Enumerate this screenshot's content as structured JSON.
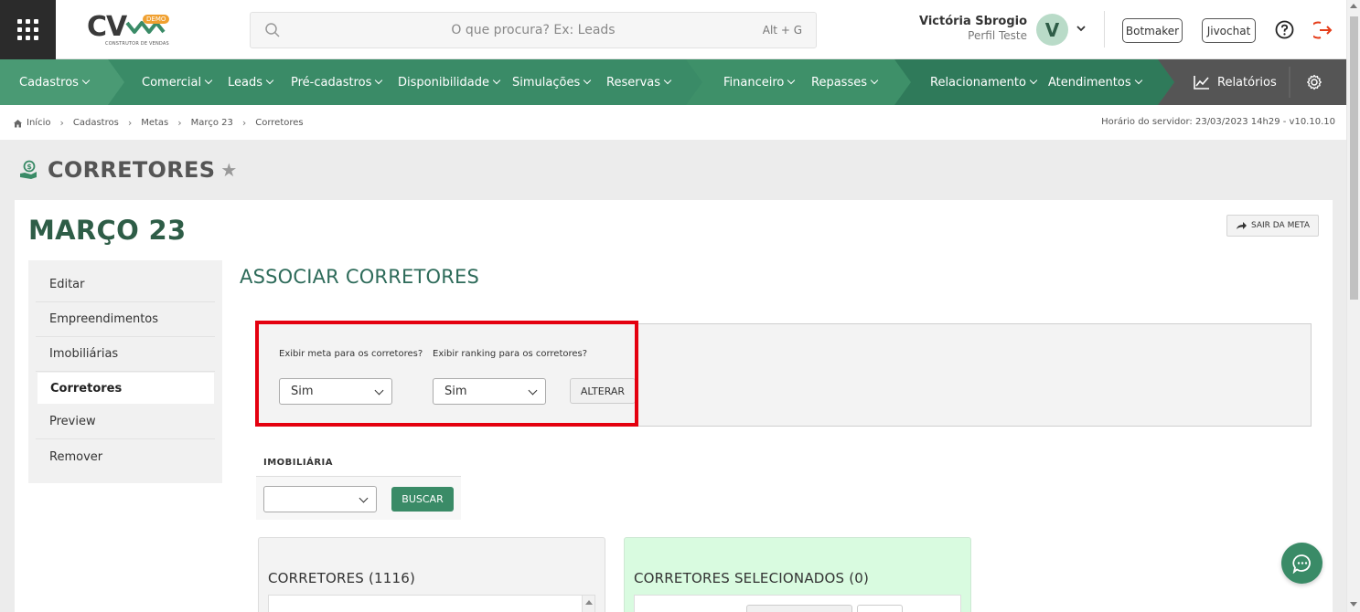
{
  "header": {
    "logo_text": "CV",
    "logo_badge": "DEMO",
    "logo_subtitle": "CONSTRUTOR DE VENDAS",
    "search_placeholder": "O que procura? Ex: Leads",
    "search_shortcut": "Alt + G",
    "user_name": "Victória Sbrogio",
    "user_role": "Perfil Teste",
    "avatar_initial": "V",
    "botmaker_label": "Botmaker",
    "jivochat_label": "Jivochat"
  },
  "nav": {
    "items": [
      {
        "label": "Cadastros"
      },
      {
        "label": "Comercial"
      },
      {
        "label": "Leads"
      },
      {
        "label": "Pré-cadastros"
      },
      {
        "label": "Disponibilidade"
      },
      {
        "label": "Simulações"
      },
      {
        "label": "Reservas"
      },
      {
        "label": "Financeiro"
      },
      {
        "label": "Repasses"
      },
      {
        "label": "Relacionamento"
      },
      {
        "label": "Atendimentos"
      }
    ],
    "reports_label": "Relatórios",
    "colors": {
      "nav": "#3a8b67",
      "dark": "#2d6e54",
      "reports": "#555555",
      "accent": "#2e5d47",
      "highlight": "#e4000f"
    }
  },
  "breadcrumb": {
    "items": [
      "Início",
      "Cadastros",
      "Metas",
      "Março 23",
      "Corretores"
    ],
    "server_time": "Horário do servidor: 23/03/2023 14h29 - v10.10.10"
  },
  "page": {
    "title": "CORRETORES",
    "card_title": "MARÇO 23",
    "exit_label": "SAIR DA META"
  },
  "sidemenu": {
    "items": [
      {
        "label": "Editar"
      },
      {
        "label": "Empreendimentos"
      },
      {
        "label": "Imobiliárias"
      },
      {
        "label": "Corretores"
      },
      {
        "label": "Preview"
      },
      {
        "label": "Remover"
      }
    ]
  },
  "main": {
    "section_title": "ASSOCIAR CORRETORES",
    "show_goal_label": "Exibir meta para os corretores?",
    "show_goal_value": "Sim",
    "show_ranking_label": "Exibir ranking para os corretores?",
    "show_ranking_value": "Sim",
    "alter_label": "ALTERAR",
    "imob_label": "IMOBILIÁRIA",
    "imob_value": "",
    "search_label": "BUSCAR",
    "brokers_title": "CORRETORES (1116)",
    "selected_title": "CORRETORES SELECIONADOS (0)"
  }
}
